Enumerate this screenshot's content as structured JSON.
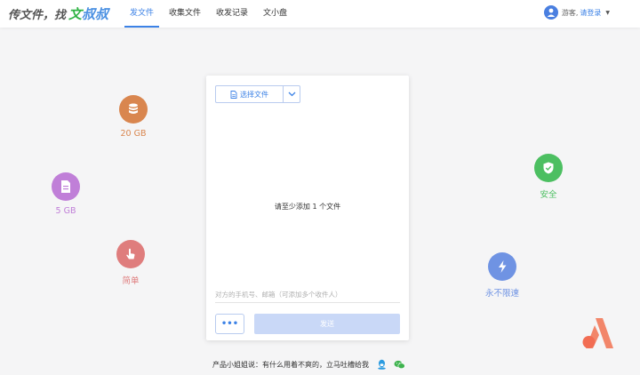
{
  "logo": {
    "part1": "传文件，找 ",
    "part2_green": "文",
    "part2_blue": "叔叔"
  },
  "nav": [
    {
      "label": "发文件",
      "active": true
    },
    {
      "label": "收集文件",
      "active": false
    },
    {
      "label": "收发记录",
      "active": false
    },
    {
      "label": "文小盘",
      "active": false
    }
  ],
  "user": {
    "guest": "游客,",
    "login": "请登录"
  },
  "features": {
    "size_20gb": {
      "label": "20 GB",
      "color": "#d9864f",
      "icon": "database-icon"
    },
    "size_5gb": {
      "label": "5 GB",
      "color": "#c07fd8",
      "icon": "document-icon"
    },
    "simple": {
      "label": "简单",
      "color": "#df7d7d",
      "icon": "tap-icon"
    },
    "secure": {
      "label": "安全",
      "color": "#4cbf61",
      "icon": "shield-check-icon"
    },
    "unlimited": {
      "label": "永不限速",
      "color": "#6f93e3",
      "icon": "lightning-icon"
    }
  },
  "card": {
    "choose_label": "选择文件",
    "hint": "请至少添加 1 个文件",
    "recipient_placeholder": "对方的手机号、邮箱（可添加多个收件人）",
    "more_label": "•••",
    "send_label": "发送"
  },
  "footer": {
    "text": "产品小姐姐说：有什么用着不爽的，立马吐槽给我"
  }
}
